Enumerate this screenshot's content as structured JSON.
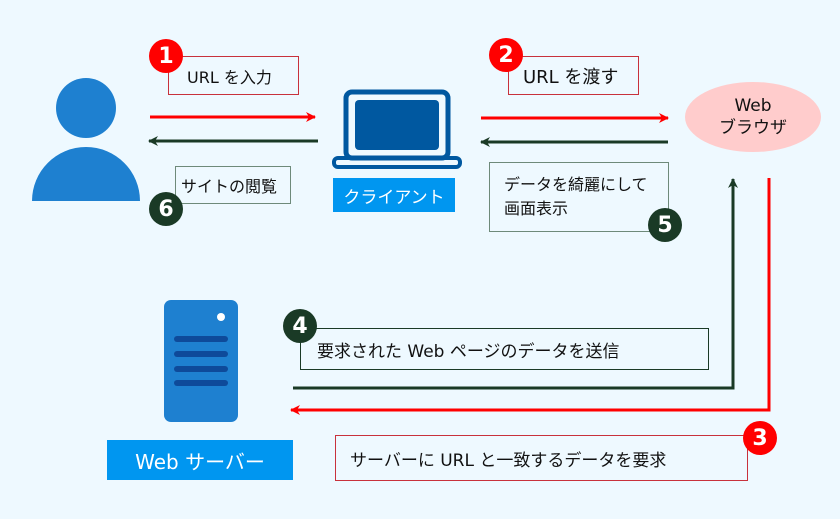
{
  "colors": {
    "background": "#eef9ff",
    "request": "#ff0000",
    "response": "#1a3a26",
    "label_bg": "#0096f0",
    "icon_blue": "#1e80d0",
    "browser_fill": "#ffcccc"
  },
  "nodes": {
    "user": {
      "icon": "person-icon"
    },
    "client": {
      "icon": "laptop-icon",
      "label": "クライアント"
    },
    "browser": {
      "line1": "Web",
      "line2": "ブラウザ"
    },
    "server": {
      "icon": "server-icon",
      "label": "Web サーバー"
    }
  },
  "steps": [
    {
      "num": "1",
      "text": "URL を入力"
    },
    {
      "num": "2",
      "text": "URL を渡す"
    },
    {
      "num": "3",
      "text": "サーバーに URL と一致するデータを要求"
    },
    {
      "num": "4",
      "text": "要求された Web ページのデータを送信"
    },
    {
      "num": "5",
      "line1": "データを綺麗にして",
      "line2": "画面表示"
    },
    {
      "num": "6",
      "text": "サイトの閲覧"
    }
  ]
}
